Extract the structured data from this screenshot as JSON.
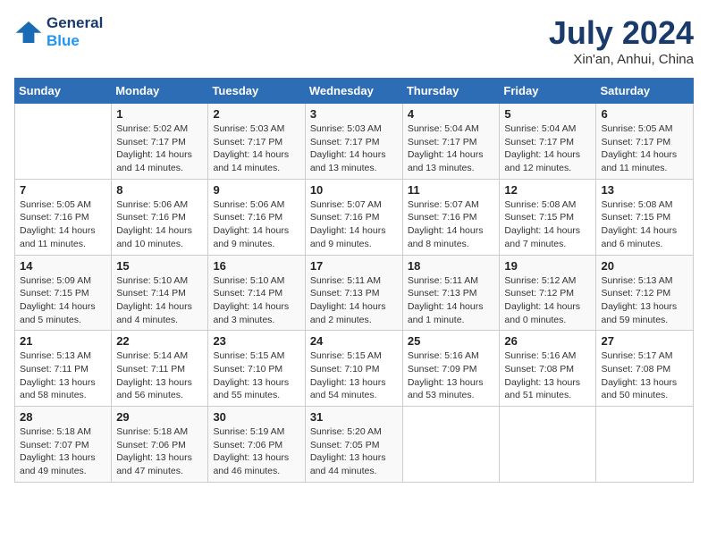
{
  "header": {
    "logo_line1": "General",
    "logo_line2": "Blue",
    "month_year": "July 2024",
    "location": "Xin'an, Anhui, China"
  },
  "columns": [
    "Sunday",
    "Monday",
    "Tuesday",
    "Wednesday",
    "Thursday",
    "Friday",
    "Saturday"
  ],
  "rows": [
    [
      {
        "day": "",
        "info": ""
      },
      {
        "day": "1",
        "info": "Sunrise: 5:02 AM\nSunset: 7:17 PM\nDaylight: 14 hours\nand 14 minutes."
      },
      {
        "day": "2",
        "info": "Sunrise: 5:03 AM\nSunset: 7:17 PM\nDaylight: 14 hours\nand 14 minutes."
      },
      {
        "day": "3",
        "info": "Sunrise: 5:03 AM\nSunset: 7:17 PM\nDaylight: 14 hours\nand 13 minutes."
      },
      {
        "day": "4",
        "info": "Sunrise: 5:04 AM\nSunset: 7:17 PM\nDaylight: 14 hours\nand 13 minutes."
      },
      {
        "day": "5",
        "info": "Sunrise: 5:04 AM\nSunset: 7:17 PM\nDaylight: 14 hours\nand 12 minutes."
      },
      {
        "day": "6",
        "info": "Sunrise: 5:05 AM\nSunset: 7:17 PM\nDaylight: 14 hours\nand 11 minutes."
      }
    ],
    [
      {
        "day": "7",
        "info": "Sunrise: 5:05 AM\nSunset: 7:16 PM\nDaylight: 14 hours\nand 11 minutes."
      },
      {
        "day": "8",
        "info": "Sunrise: 5:06 AM\nSunset: 7:16 PM\nDaylight: 14 hours\nand 10 minutes."
      },
      {
        "day": "9",
        "info": "Sunrise: 5:06 AM\nSunset: 7:16 PM\nDaylight: 14 hours\nand 9 minutes."
      },
      {
        "day": "10",
        "info": "Sunrise: 5:07 AM\nSunset: 7:16 PM\nDaylight: 14 hours\nand 9 minutes."
      },
      {
        "day": "11",
        "info": "Sunrise: 5:07 AM\nSunset: 7:16 PM\nDaylight: 14 hours\nand 8 minutes."
      },
      {
        "day": "12",
        "info": "Sunrise: 5:08 AM\nSunset: 7:15 PM\nDaylight: 14 hours\nand 7 minutes."
      },
      {
        "day": "13",
        "info": "Sunrise: 5:08 AM\nSunset: 7:15 PM\nDaylight: 14 hours\nand 6 minutes."
      }
    ],
    [
      {
        "day": "14",
        "info": "Sunrise: 5:09 AM\nSunset: 7:15 PM\nDaylight: 14 hours\nand 5 minutes."
      },
      {
        "day": "15",
        "info": "Sunrise: 5:10 AM\nSunset: 7:14 PM\nDaylight: 14 hours\nand 4 minutes."
      },
      {
        "day": "16",
        "info": "Sunrise: 5:10 AM\nSunset: 7:14 PM\nDaylight: 14 hours\nand 3 minutes."
      },
      {
        "day": "17",
        "info": "Sunrise: 5:11 AM\nSunset: 7:13 PM\nDaylight: 14 hours\nand 2 minutes."
      },
      {
        "day": "18",
        "info": "Sunrise: 5:11 AM\nSunset: 7:13 PM\nDaylight: 14 hours\nand 1 minute."
      },
      {
        "day": "19",
        "info": "Sunrise: 5:12 AM\nSunset: 7:12 PM\nDaylight: 14 hours\nand 0 minutes."
      },
      {
        "day": "20",
        "info": "Sunrise: 5:13 AM\nSunset: 7:12 PM\nDaylight: 13 hours\nand 59 minutes."
      }
    ],
    [
      {
        "day": "21",
        "info": "Sunrise: 5:13 AM\nSunset: 7:11 PM\nDaylight: 13 hours\nand 58 minutes."
      },
      {
        "day": "22",
        "info": "Sunrise: 5:14 AM\nSunset: 7:11 PM\nDaylight: 13 hours\nand 56 minutes."
      },
      {
        "day": "23",
        "info": "Sunrise: 5:15 AM\nSunset: 7:10 PM\nDaylight: 13 hours\nand 55 minutes."
      },
      {
        "day": "24",
        "info": "Sunrise: 5:15 AM\nSunset: 7:10 PM\nDaylight: 13 hours\nand 54 minutes."
      },
      {
        "day": "25",
        "info": "Sunrise: 5:16 AM\nSunset: 7:09 PM\nDaylight: 13 hours\nand 53 minutes."
      },
      {
        "day": "26",
        "info": "Sunrise: 5:16 AM\nSunset: 7:08 PM\nDaylight: 13 hours\nand 51 minutes."
      },
      {
        "day": "27",
        "info": "Sunrise: 5:17 AM\nSunset: 7:08 PM\nDaylight: 13 hours\nand 50 minutes."
      }
    ],
    [
      {
        "day": "28",
        "info": "Sunrise: 5:18 AM\nSunset: 7:07 PM\nDaylight: 13 hours\nand 49 minutes."
      },
      {
        "day": "29",
        "info": "Sunrise: 5:18 AM\nSunset: 7:06 PM\nDaylight: 13 hours\nand 47 minutes."
      },
      {
        "day": "30",
        "info": "Sunrise: 5:19 AM\nSunset: 7:06 PM\nDaylight: 13 hours\nand 46 minutes."
      },
      {
        "day": "31",
        "info": "Sunrise: 5:20 AM\nSunset: 7:05 PM\nDaylight: 13 hours\nand 44 minutes."
      },
      {
        "day": "",
        "info": ""
      },
      {
        "day": "",
        "info": ""
      },
      {
        "day": "",
        "info": ""
      }
    ]
  ]
}
